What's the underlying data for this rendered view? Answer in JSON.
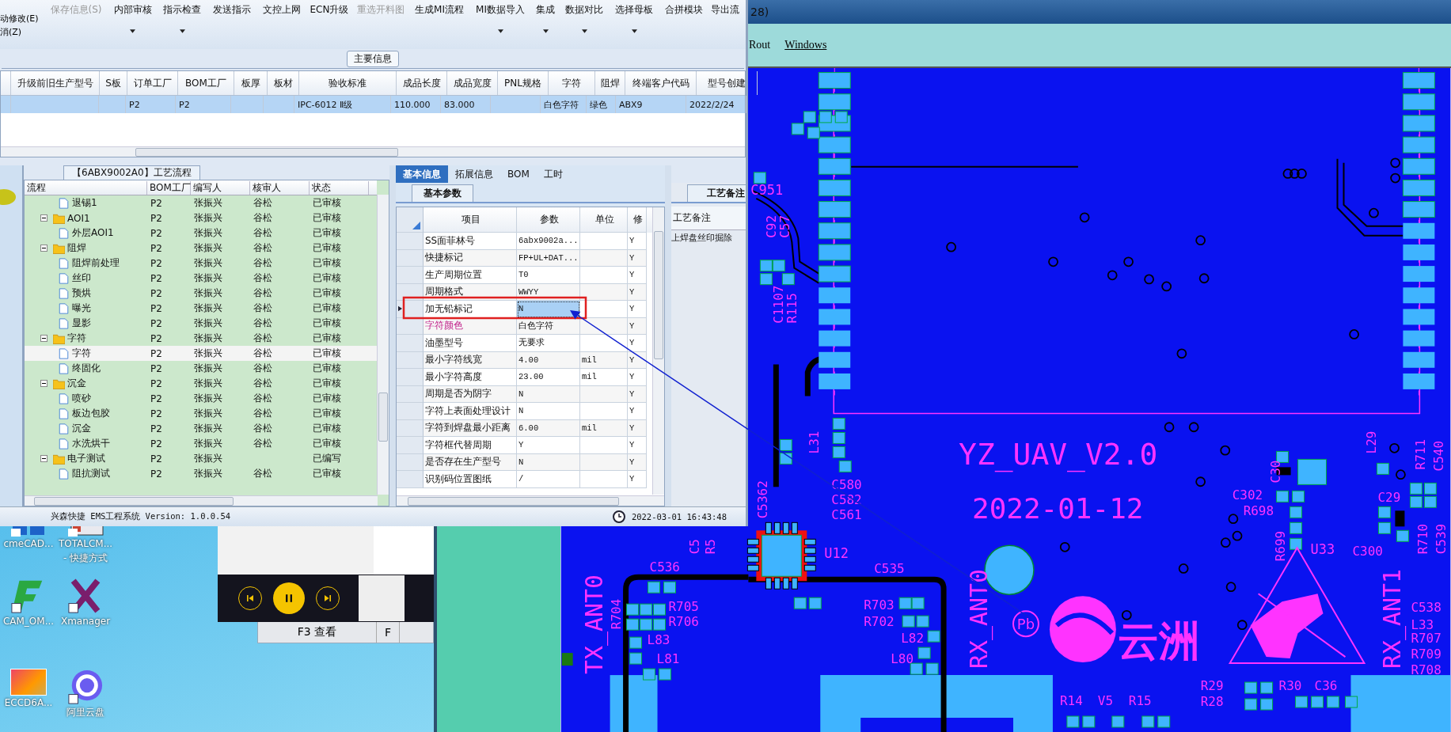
{
  "app_window": {
    "ribbon": {
      "side_items": [
        "动修改(E)",
        "消(Z)"
      ],
      "buttons": [
        {
          "label": "保存信息(S)",
          "disabled": true,
          "dropdown": false
        },
        {
          "label": "内部审核",
          "disabled": false,
          "dropdown": true
        },
        {
          "label": "指示检查",
          "disabled": false,
          "dropdown": true
        },
        {
          "label": "发送指示",
          "disabled": false,
          "dropdown": false
        },
        {
          "label": "文控上网",
          "disabled": false,
          "dropdown": false
        },
        {
          "label": "ECN升级",
          "disabled": false,
          "dropdown": false
        },
        {
          "label": "重选开料图",
          "disabled": true,
          "dropdown": false
        },
        {
          "label": "生成MI流程",
          "disabled": false,
          "dropdown": false
        },
        {
          "label": "MI数据导入",
          "disabled": false,
          "dropdown": true
        },
        {
          "label": "集成",
          "disabled": false,
          "dropdown": true
        },
        {
          "label": "数据对比",
          "disabled": false,
          "dropdown": true
        },
        {
          "label": "选择母板",
          "disabled": false,
          "dropdown": true
        },
        {
          "label": "合拼模块",
          "disabled": false,
          "dropdown": false
        },
        {
          "label": "导出流",
          "disabled": false,
          "dropdown": false
        }
      ]
    },
    "main_info": {
      "group_title": "主要信息",
      "columns": [
        "升级前旧生产型号",
        "S板",
        "订单工厂",
        "BOM工厂",
        "板厚",
        "板材",
        "验收标准",
        "成品长度",
        "成品宽度",
        "PNL规格",
        "字符",
        "阻焊",
        "终端客户代码",
        "型号创建"
      ],
      "rows": [
        {
          "selected": true,
          "cells": [
            null,
            null,
            "P2",
            "P2",
            null,
            null,
            "IPC-6012 Ⅱ级",
            "110.000",
            "83.000",
            null,
            "白色字符",
            "绿色",
            "ABX9",
            "2022/2/24"
          ]
        }
      ]
    },
    "flow_panel": {
      "title": "【6ABX9002A0】工艺流程",
      "columns": [
        "流程",
        "BOM工厂",
        "编写人",
        "核审人",
        "状态"
      ],
      "tree": [
        {
          "label": "退锡1",
          "kind": "file",
          "selected": false,
          "bom_factory": "P2",
          "writer": "张振兴",
          "reviewer": "谷松",
          "status": "已审核"
        },
        {
          "label": "AOI1",
          "kind": "folder",
          "expanded": true,
          "selected": false,
          "bom_factory": "P2",
          "writer": "张振兴",
          "reviewer": "谷松",
          "status": "已审核",
          "children": [
            {
              "label": "外层AOI1",
              "kind": "file",
              "selected": false,
              "bom_factory": "P2",
              "writer": "张振兴",
              "reviewer": "谷松",
              "status": "已审核"
            }
          ]
        },
        {
          "label": "阻焊",
          "kind": "folder",
          "expanded": true,
          "selected": false,
          "bom_factory": "P2",
          "writer": "张振兴",
          "reviewer": "谷松",
          "status": "已审核",
          "children": [
            {
              "label": "阻焊前处理",
              "kind": "file",
              "selected": false,
              "bom_factory": "P2",
              "writer": "张振兴",
              "reviewer": "谷松",
              "status": "已审核"
            },
            {
              "label": "丝印",
              "kind": "file",
              "selected": false,
              "bom_factory": "P2",
              "writer": "张振兴",
              "reviewer": "谷松",
              "status": "已审核"
            },
            {
              "label": "预烘",
              "kind": "file",
              "selected": false,
              "bom_factory": "P2",
              "writer": "张振兴",
              "reviewer": "谷松",
              "status": "已审核"
            },
            {
              "label": "曝光",
              "kind": "file",
              "selected": false,
              "bom_factory": "P2",
              "writer": "张振兴",
              "reviewer": "谷松",
              "status": "已审核"
            },
            {
              "label": "显影",
              "kind": "file",
              "selected": false,
              "bom_factory": "P2",
              "writer": "张振兴",
              "reviewer": "谷松",
              "status": "已审核"
            }
          ]
        },
        {
          "label": "字符",
          "kind": "folder",
          "expanded": true,
          "selected": false,
          "bom_factory": "P2",
          "writer": "张振兴",
          "reviewer": "谷松",
          "status": "已审核",
          "children": [
            {
              "label": "字符",
              "kind": "file",
              "selected": true,
              "bom_factory": "P2",
              "writer": "张振兴",
              "reviewer": "谷松",
              "status": "已审核"
            },
            {
              "label": "终固化",
              "kind": "file",
              "selected": false,
              "bom_factory": "P2",
              "writer": "张振兴",
              "reviewer": "谷松",
              "status": "已审核"
            }
          ]
        },
        {
          "label": "沉金",
          "kind": "folder",
          "expanded": true,
          "selected": false,
          "bom_factory": "P2",
          "writer": "张振兴",
          "reviewer": "谷松",
          "status": "已审核",
          "children": [
            {
              "label": "喷砂",
              "kind": "file",
              "selected": false,
              "bom_factory": "P2",
              "writer": "张振兴",
              "reviewer": "谷松",
              "status": "已审核"
            },
            {
              "label": "板边包胶",
              "kind": "file",
              "selected": false,
              "bom_factory": "P2",
              "writer": "张振兴",
              "reviewer": "谷松",
              "status": "已审核"
            },
            {
              "label": "沉金",
              "kind": "file",
              "selected": false,
              "bom_factory": "P2",
              "writer": "张振兴",
              "reviewer": "谷松",
              "status": "已审核"
            },
            {
              "label": "水洗烘干",
              "kind": "file",
              "selected": false,
              "bom_factory": "P2",
              "writer": "张振兴",
              "reviewer": "谷松",
              "status": "已审核"
            }
          ]
        },
        {
          "label": "电子测试",
          "kind": "folder",
          "expanded": true,
          "selected": false,
          "bom_factory": "P2",
          "writer": "张振兴",
          "status": "已编写",
          "children": [
            {
              "label": "阻抗测试",
              "kind": "file",
              "selected": false,
              "bom_factory": "P2",
              "writer": "张振兴",
              "reviewer": "谷松",
              "status": "已审核"
            }
          ]
        }
      ]
    },
    "detail_panel": {
      "tabs": [
        {
          "label": "基本信息",
          "selected": true
        },
        {
          "label": "拓展信息",
          "selected": false
        },
        {
          "label": "BOM",
          "selected": false
        },
        {
          "label": "工时",
          "selected": false
        }
      ],
      "subtab": "基本参数",
      "columns": [
        "项目",
        "参数",
        "单位",
        "修"
      ],
      "rows": [
        {
          "item": "SS面菲林号",
          "value": "6abx9002a...",
          "unit": null,
          "modified": "Y",
          "selected": false,
          "highlighted": false
        },
        {
          "item": "快捷标记",
          "value": "FP+UL+DAT...",
          "unit": null,
          "modified": "Y",
          "selected": false,
          "highlighted": false
        },
        {
          "item": "生产周期位置",
          "value": "T0",
          "unit": null,
          "modified": "Y",
          "selected": false,
          "highlighted": false
        },
        {
          "item": "周期格式",
          "value": "WWYY",
          "unit": null,
          "modified": "Y",
          "selected": false,
          "highlighted": false
        },
        {
          "item": "加无铅标记",
          "value": "N",
          "unit": null,
          "modified": "Y",
          "selected": true,
          "highlighted": false
        },
        {
          "item": "字符颜色",
          "value": "白色字符",
          "unit": null,
          "modified": "Y",
          "selected": false,
          "highlighted": true
        },
        {
          "item": "油墨型号",
          "value": "无要求",
          "unit": null,
          "modified": "Y",
          "selected": false,
          "highlighted": false
        },
        {
          "item": "最小字符线宽",
          "value": "4.00",
          "unit": "mil",
          "modified": "Y",
          "selected": false,
          "highlighted": false
        },
        {
          "item": "最小字符高度",
          "value": "23.00",
          "unit": "mil",
          "modified": "Y",
          "selected": false,
          "highlighted": false
        },
        {
          "item": "周期是否为阴字",
          "value": "N",
          "unit": null,
          "modified": "Y",
          "selected": false,
          "highlighted": false
        },
        {
          "item": "字符上表面处理设计",
          "value": "N",
          "unit": null,
          "modified": "Y",
          "selected": false,
          "highlighted": false
        },
        {
          "item": "字符到焊盘最小距离",
          "value": "6.00",
          "unit": "mil",
          "modified": "Y",
          "selected": false,
          "highlighted": false
        },
        {
          "item": "字符框代替周期",
          "value": "Y",
          "unit": null,
          "modified": "Y",
          "selected": false,
          "highlighted": false
        },
        {
          "item": "是否存在生产型号",
          "value": "N",
          "unit": null,
          "modified": "Y",
          "selected": false,
          "highlighted": false
        },
        {
          "item": "识别码位置图纸",
          "value": "/",
          "unit": null,
          "modified": "Y",
          "selected": false,
          "highlighted": false
        }
      ]
    },
    "notes_panel": {
      "tab": "工艺备注",
      "header": "工艺备注",
      "text": "上焊盘丝印掘除"
    },
    "status_bar": {
      "app": "兴森快捷 EMS工程系统 Version: 1.0.0.54",
      "datetime": "2022-03-01 16:43:48"
    }
  },
  "desktop": {
    "icons": [
      {
        "kind": "cad",
        "lines": [
          "cmeCAD..."
        ]
      },
      {
        "kind": "commander",
        "lines": [
          "TOTALCM...",
          "- 快捷方式"
        ]
      },
      {
        "kind": "cam",
        "lines": [
          "CAM_OM..."
        ]
      },
      {
        "kind": "xmanager",
        "lines": [
          "Xmanager"
        ]
      },
      {
        "kind": "photo",
        "lines": [
          "ECCD6A..."
        ]
      },
      {
        "kind": "cloud",
        "lines": [
          "阿里云盘"
        ]
      }
    ]
  },
  "media_player": {
    "playing": true,
    "tabs": [
      "F3 查看",
      "F"
    ]
  },
  "pcb_window": {
    "title": "28)",
    "menu": [
      "Rout",
      "Windows"
    ],
    "logo_text": "云洲",
    "pb_mark": "Pb",
    "silkscreen": [
      "YZ_UAV_V2.0",
      "2022-01-12",
      "TX_ANT0",
      "RX_ANT0",
      "RX_ANT1",
      "U12",
      "U33",
      "C580",
      "C582",
      "C561",
      "L31",
      "C5362",
      "C535",
      "R703",
      "R702",
      "L82",
      "L80",
      "C536",
      "R705",
      "R706",
      "L83",
      "L81",
      "R704",
      "C30",
      "C302",
      "R698",
      "R699",
      "C300",
      "L29",
      "C29",
      "R711",
      "C540",
      "R710",
      "C539",
      "C538",
      "L33",
      "R707",
      "R709",
      "R708",
      "R29",
      "R28",
      "R30",
      "C36",
      "R14",
      "V5",
      "R15",
      "C951",
      "C92",
      "C57",
      "C1107",
      "R115",
      "C5",
      "R5"
    ]
  }
}
